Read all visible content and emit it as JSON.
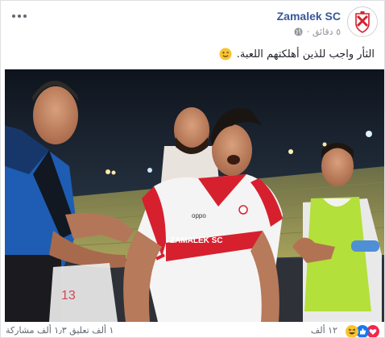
{
  "post": {
    "page_name": "Zamalek SC",
    "time": "٥ دقائق ·",
    "text": "الثأر واجب للذين أهلكتهم اللعبة.",
    "emoji_icon": "winking-face-icon",
    "privacy_icon": "globe-icon",
    "more_icon": "more-options-icon"
  },
  "photo": {
    "jersey_sponsor": "oppo",
    "jersey_text": "ZAMALEK SC",
    "kit_brand_icon": "puma-logo-icon"
  },
  "reactions": {
    "icons": [
      "haha-icon",
      "like-icon",
      "love-icon"
    ],
    "count": "١٢ ألف",
    "stats": "١ ألف تعليق ١٫٣ ألف مشاركة"
  },
  "colors": {
    "link": "#385898",
    "zamalek_red": "#d6202e",
    "vest_green": "#b3e03a",
    "referee_blue": "#1e5db3"
  }
}
